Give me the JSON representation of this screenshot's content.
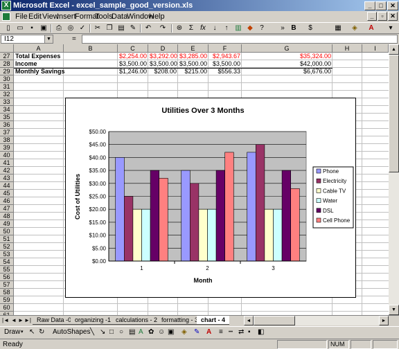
{
  "window": {
    "title": "Microsoft Excel - excel_sample_good_version.xls",
    "app_icon": "excel-icon",
    "title_color": "#0a246a"
  },
  "menu": [
    {
      "label": "File"
    },
    {
      "label": "Edit"
    },
    {
      "label": "View"
    },
    {
      "label": "Insert"
    },
    {
      "label": "Format"
    },
    {
      "label": "Tools"
    },
    {
      "label": "Data"
    },
    {
      "label": "Window"
    },
    {
      "label": "Help"
    }
  ],
  "toolbar": {
    "icons": [
      "new-icon",
      "open-icon",
      "save-icon",
      "permission-icon",
      "email-icon",
      "print-icon",
      "print-preview-icon",
      "spelling-icon",
      "cut-icon",
      "copy-icon",
      "paste-icon",
      "format-painter-icon",
      "undo-icon",
      "redo-icon",
      "hyperlink-icon",
      "autosum-icon",
      "function-icon",
      "sort-ascending-icon",
      "sort-descending-icon",
      "chart-wizard-icon",
      "drawing-icon",
      "zoom-icon",
      "bold-icon",
      "currency-icon",
      "borders-icon",
      "fill-color-icon",
      "font-color-icon"
    ],
    "autosum_glyph": "Σ",
    "function_glyph": "fx",
    "currency_glyph": "$"
  },
  "formula_bar": {
    "name_box": "I12",
    "equals": "=",
    "value": ""
  },
  "columns": [
    "A",
    "B",
    "C",
    "D",
    "E",
    "F",
    "G",
    "H",
    "I"
  ],
  "rows": [
    "27",
    "28",
    "29",
    "30",
    "31",
    "32",
    "33",
    "34",
    "35",
    "36",
    "37",
    "38",
    "39",
    "40",
    "41",
    "42",
    "43",
    "44",
    "45",
    "46",
    "47",
    "48",
    "49",
    "50",
    "51",
    "52",
    "53",
    "54",
    "55",
    "56",
    "57",
    "58",
    "59",
    "60",
    "61"
  ],
  "data_rows": [
    {
      "label": "Total Expenses",
      "values": [
        "$2,254.00",
        "$3,292.00",
        "$3,285.00",
        "$2,943.67"
      ],
      "total": "$35,324.00"
    },
    {
      "label": "Income",
      "values": [
        "$3,500.00",
        "$3,500.00",
        "$3,500.00",
        "$3,500.00"
      ],
      "total": "$42,000.00"
    },
    {
      "label": "Monthly Savings",
      "values": [
        "$1,246.00",
        "$208.00",
        "$215.00",
        "$556.33"
      ],
      "total": "$6,676.00"
    }
  ],
  "colors": {
    "expense_text": "#ff0000",
    "plot_bg": "#c0c0c0"
  },
  "chart_data": {
    "type": "bar",
    "title": "Utilities Over 3 Months",
    "xlabel": "Month",
    "ylabel": "Cost of Utilities",
    "categories": [
      "1",
      "2",
      "3"
    ],
    "ylim": [
      0,
      50
    ],
    "ytick_labels": [
      "$0.00",
      "$5.00",
      "$10.00",
      "$15.00",
      "$20.00",
      "$25.00",
      "$30.00",
      "$35.00",
      "$40.00",
      "$45.00",
      "$50.00"
    ],
    "grid": true,
    "legend_position": "right",
    "series": [
      {
        "name": "Phone",
        "values": [
          40,
          35,
          42
        ],
        "color": "#9999ff"
      },
      {
        "name": "Electricity",
        "values": [
          25,
          30,
          45
        ],
        "color": "#993366"
      },
      {
        "name": "Cable TV",
        "values": [
          20,
          20,
          20
        ],
        "color": "#ffffcc"
      },
      {
        "name": "Water",
        "values": [
          20,
          20,
          20
        ],
        "color": "#ccffff"
      },
      {
        "name": "DSL",
        "values": [
          35,
          35,
          35
        ],
        "color": "#660066"
      },
      {
        "name": "Cell Phone",
        "values": [
          32,
          42,
          28
        ],
        "color": "#ff8080"
      }
    ]
  },
  "sheet_tabs": [
    {
      "label": "Raw Data -0",
      "active": false
    },
    {
      "label": "organizing -1",
      "active": false
    },
    {
      "label": "calculations - 2",
      "active": false
    },
    {
      "label": "formatting - 3",
      "active": false
    },
    {
      "label": "chart - 4",
      "active": true
    }
  ],
  "drawing_toolbar": {
    "draw_label": "Draw",
    "autoshapes_label": "AutoShapes"
  },
  "status": {
    "text": "Ready",
    "num": "NUM"
  }
}
